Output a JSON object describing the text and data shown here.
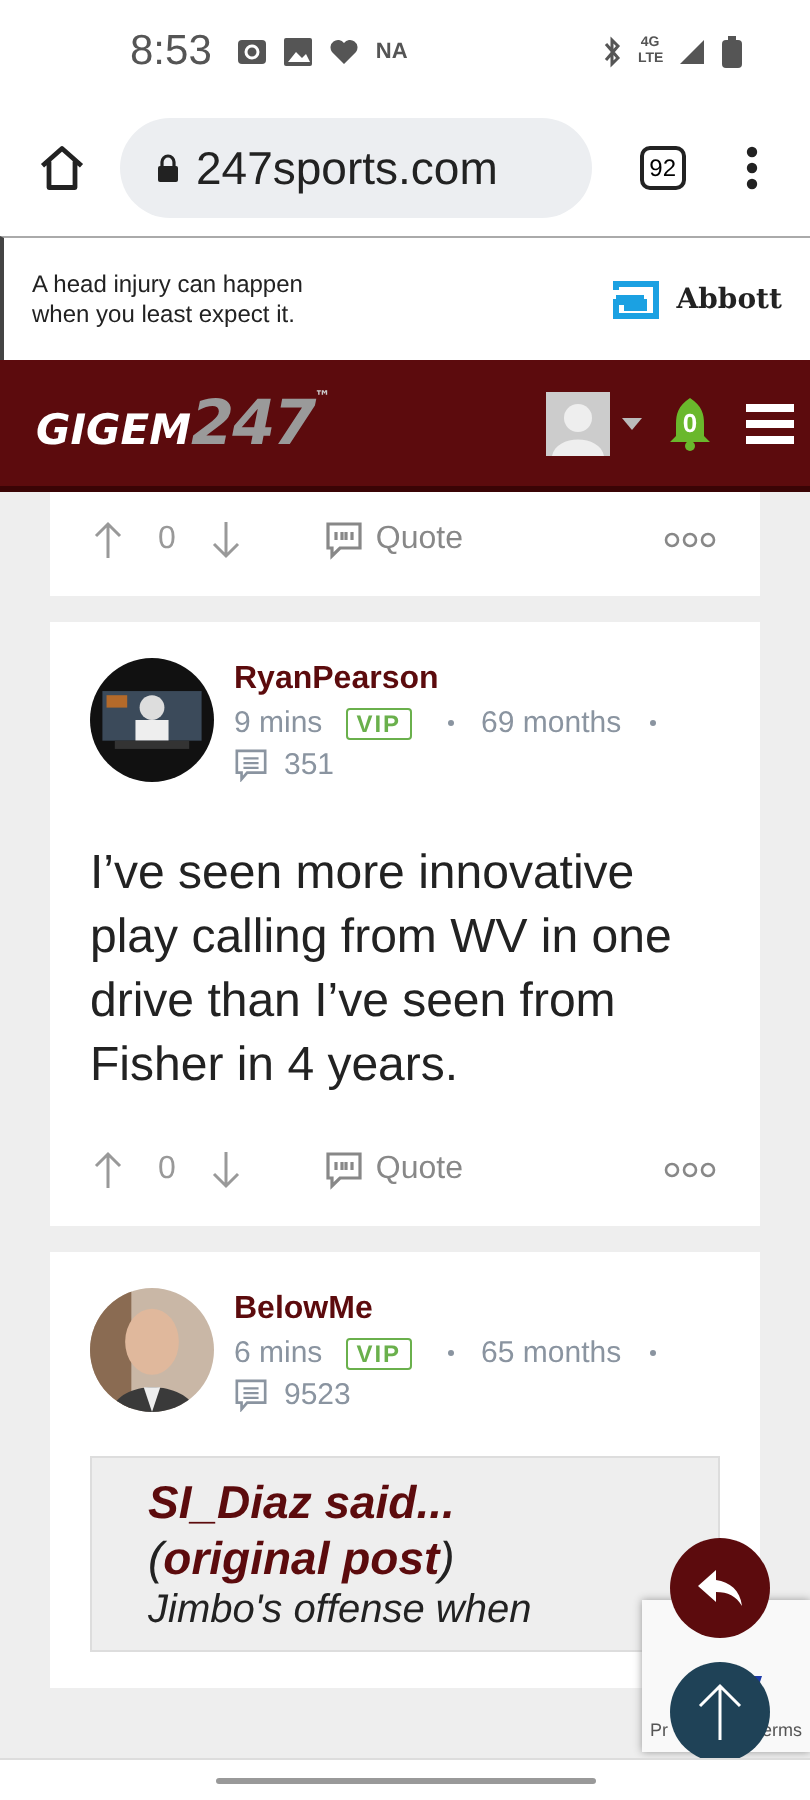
{
  "status_bar": {
    "time": "8:53",
    "carrier": "NA",
    "network": "4G LTE"
  },
  "browser": {
    "url": "247sports.com",
    "tab_count": "92"
  },
  "ad": {
    "text": "A head injury can happen when you least expect it.",
    "brand": "Abbott"
  },
  "header": {
    "logo": {
      "main": "GIGEM",
      "number": "247",
      "trademark": "™"
    },
    "notifications": "0"
  },
  "posts": [
    {
      "kind": "partial",
      "votes": "0",
      "quote_label": "Quote"
    },
    {
      "kind": "full",
      "author": "RyanPearson",
      "time": "9 mins",
      "badge": "VIP",
      "tenure": "69 months",
      "post_count": "351",
      "body": "I’ve seen more innovative play calling from WV in one drive than I’ve seen from Fisher in 4 years.",
      "votes": "0",
      "quote_label": "Quote"
    },
    {
      "kind": "quoted",
      "author": "BelowMe",
      "time": "6 mins",
      "badge": "VIP",
      "tenure": "65 months",
      "post_count": "9523",
      "quote": {
        "title": "SI_Diaz said...",
        "open": "(",
        "link": "original post",
        "close": ")",
        "text": "Jimbo's offense when"
      }
    }
  ],
  "recaptcha": {
    "left": "Pr",
    "right": "erms"
  }
}
